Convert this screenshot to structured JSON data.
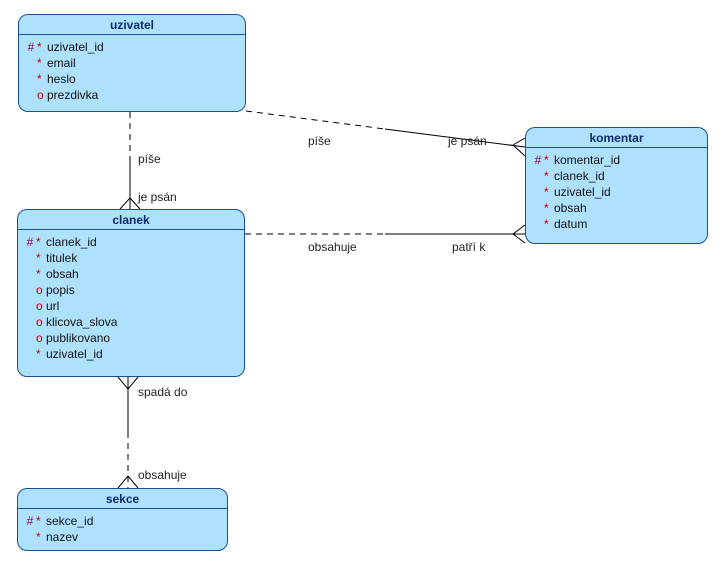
{
  "entities": {
    "uzivatel": {
      "title": "uzivatel",
      "attrs": [
        {
          "m1": "#",
          "m2": "*",
          "name": "uzivatel_id"
        },
        {
          "m1": "",
          "m2": "*",
          "name": "email"
        },
        {
          "m1": "",
          "m2": "*",
          "name": "heslo"
        },
        {
          "m1": "",
          "m2": "o",
          "name": "prezdivka"
        }
      ]
    },
    "clanek": {
      "title": "clanek",
      "attrs": [
        {
          "m1": "#",
          "m2": "*",
          "name": "clanek_id"
        },
        {
          "m1": "",
          "m2": "*",
          "name": "titulek"
        },
        {
          "m1": "",
          "m2": "*",
          "name": "obsah"
        },
        {
          "m1": "",
          "m2": "o",
          "name": "popis"
        },
        {
          "m1": "",
          "m2": "o",
          "name": "url"
        },
        {
          "m1": "",
          "m2": "o",
          "name": "klicova_slova"
        },
        {
          "m1": "",
          "m2": "o",
          "name": "publikovano"
        },
        {
          "m1": "",
          "m2": "*",
          "name": "uzivatel_id"
        }
      ]
    },
    "komentar": {
      "title": "komentar",
      "attrs": [
        {
          "m1": "#",
          "m2": "*",
          "name": "komentar_id"
        },
        {
          "m1": "",
          "m2": "*",
          "name": "clanek_id"
        },
        {
          "m1": "",
          "m2": "*",
          "name": "uzivatel_id"
        },
        {
          "m1": "",
          "m2": "*",
          "name": "obsah"
        },
        {
          "m1": "",
          "m2": "*",
          "name": "datum"
        }
      ]
    },
    "sekce": {
      "title": "sekce",
      "attrs": [
        {
          "m1": "#",
          "m2": "*",
          "name": "sekce_id"
        },
        {
          "m1": "",
          "m2": "*",
          "name": "nazev"
        }
      ]
    }
  },
  "labels": {
    "uz_cl_top": "píše",
    "uz_cl_bottom": "je psán",
    "uz_kom_top": "píše",
    "uz_kom_bottom": "je psán",
    "cl_kom_left": "obsahuje",
    "cl_kom_right": "patří k",
    "cl_se_top": "spadá do",
    "cl_se_bottom": "obsahuje"
  }
}
